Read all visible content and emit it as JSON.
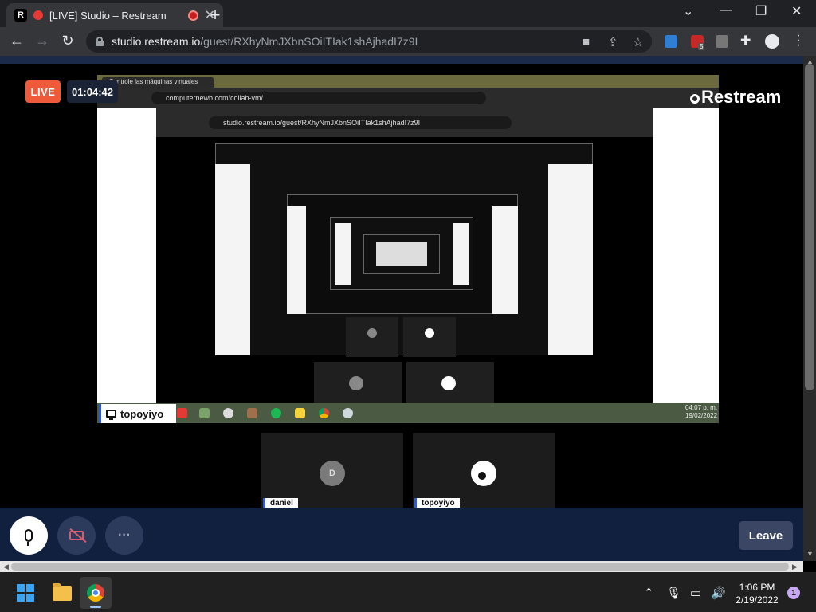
{
  "browser": {
    "tab_favicon_letter": "R",
    "tab_title": "[LIVE] Studio – Restream",
    "new_tab_label": "+",
    "url_host": "studio.restream.io",
    "url_path": "/guest/RXhyNmJXbnSOiITIak1shAjhadI7z9I",
    "extension_badge": "5"
  },
  "studio": {
    "live_label": "LIVE",
    "timer": "01:04:42",
    "brand": "Restream"
  },
  "shared_screen": {
    "tab_title": "¡Controle las máquinas virtuales",
    "url": "computernewb.com/collab-vm/",
    "inner_url": "studio.restream.io/guest/RXhyNmJXbnSOiITIak1shAjhadI7z9I",
    "presenter": "topoyiyo",
    "clock_time": "04:07 p. m.",
    "clock_date": "19/02/2022"
  },
  "participants": [
    {
      "initial": "D",
      "name": "daniel"
    },
    {
      "initial": "",
      "name": "topoyiyo"
    }
  ],
  "controls": {
    "more_label": "···",
    "leave_label": "Leave"
  },
  "taskbar": {
    "time": "1:06 PM",
    "date": "2/19/2022",
    "notification_count": "1"
  }
}
